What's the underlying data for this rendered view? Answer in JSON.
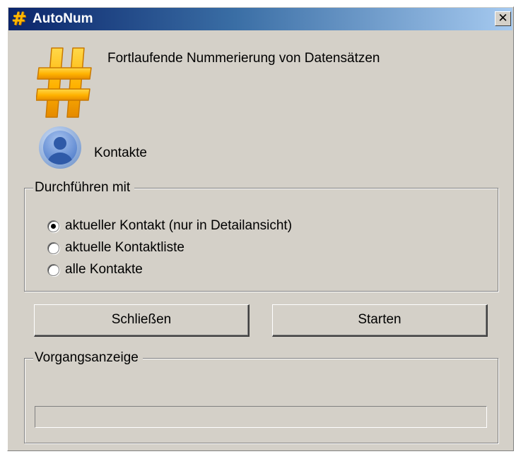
{
  "window": {
    "title": "AutoNum",
    "close_label": "✕"
  },
  "header": {
    "description": "Fortlaufende Nummerierung von Datensätzen"
  },
  "module": {
    "label": "Kontakte"
  },
  "scope_group": {
    "legend": "Durchführen mit",
    "options": [
      {
        "label": "aktueller Kontakt (nur in Detailansicht)",
        "checked": true
      },
      {
        "label": "aktuelle Kontaktliste",
        "checked": false
      },
      {
        "label": "alle Kontakte",
        "checked": false
      }
    ]
  },
  "buttons": {
    "close_label": "Schließen",
    "start_label": "Starten"
  },
  "progress_group": {
    "legend": "Vorgangsanzeige",
    "progress": 0
  },
  "colors": {
    "title_gradient_start": "#0a246a",
    "title_gradient_end": "#a6caf0",
    "dialog_background": "#d4d0c8",
    "hash_icon": "#ffb800",
    "contact_icon": "#4a78c8"
  },
  "icons": {
    "title_icon": "hash-icon",
    "header_icon": "hash-icon",
    "module_icon": "contact-person-icon"
  }
}
